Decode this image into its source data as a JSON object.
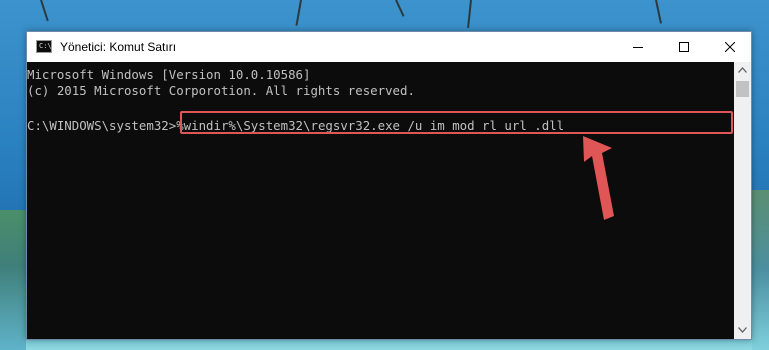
{
  "window": {
    "title": "Yönetici: Komut Satırı",
    "icon": "cmd-icon",
    "icon_glyph": "C:\\"
  },
  "controls": {
    "minimize": "minimize-icon",
    "maximize": "maximize-icon",
    "close": "close-icon"
  },
  "console": {
    "line1": "Microsoft Windows [Version 10.0.10586]",
    "line2": "(c) 2015 Microsoft Corporotion. All rights reserved.",
    "prompt": "C:\\WINDOWS\\system32>",
    "command": "%windir%\\System32\\regsvr32.exe /u im_mod_rl_url_.dll"
  },
  "annotation": {
    "highlight_color": "#e05555",
    "arrow_color": "#e05555",
    "arrow": "red-arrow-icon"
  },
  "colors": {
    "console_background": "#0c0c0c",
    "console_text": "#c0c0c0",
    "titlebar_background": "#ffffff"
  }
}
